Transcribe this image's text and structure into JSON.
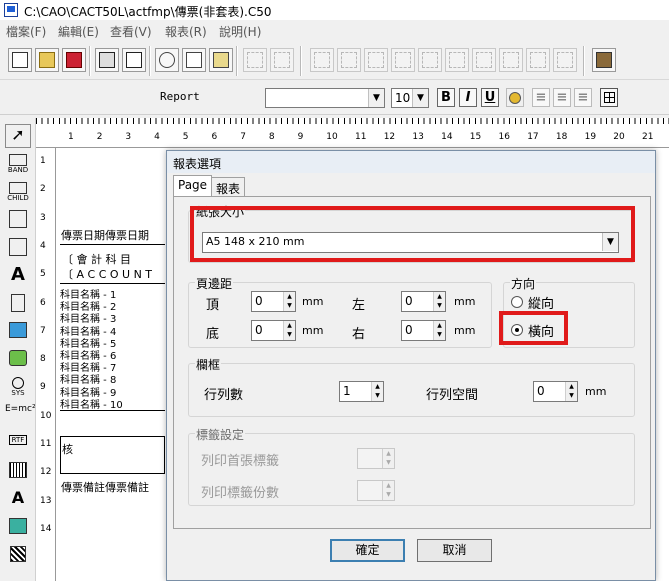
{
  "window": {
    "title": "C:\\CAO\\CACT50L\\actfmp\\傳票(非套表).C50",
    "icon": "app-icon"
  },
  "menu": [
    "檔案(F)",
    "編輯(E)",
    "查看(V)",
    "報表(R)",
    "說明(H)"
  ],
  "toolbar2": {
    "label": "Report",
    "font_value": "",
    "size_value": "10",
    "bold": "B",
    "italic": "I",
    "underline": "U"
  },
  "ruler": {
    "h_ticks": [
      "1",
      "2",
      "3",
      "4",
      "5",
      "6",
      "7",
      "8",
      "9",
      "10",
      "11",
      "12",
      "13",
      "14",
      "15",
      "16",
      "17",
      "18",
      "19",
      "20",
      "21"
    ],
    "v_ticks": [
      "1",
      "2",
      "3",
      "4",
      "5",
      "6",
      "7",
      "8",
      "9",
      "10",
      "11",
      "12",
      "13",
      "14"
    ]
  },
  "left_tools": [
    {
      "name": "pointer-tool",
      "label": ""
    },
    {
      "name": "band-tool",
      "label": "BAND"
    },
    {
      "name": "child-tool",
      "label": "CHILD"
    },
    {
      "name": "band3-tool",
      "label": ""
    },
    {
      "name": "band4-tool",
      "label": ""
    },
    {
      "name": "label-tool",
      "label": "A"
    },
    {
      "name": "memo-tool",
      "label": ""
    },
    {
      "name": "image-tool",
      "label": ""
    },
    {
      "name": "shape-tool",
      "label": ""
    },
    {
      "name": "sysdata-tool",
      "label": "SYS"
    },
    {
      "name": "expr-tool",
      "label": "E=mc²"
    },
    {
      "name": "rtf-tool",
      "label": "RTF"
    },
    {
      "name": "barcode-tool",
      "label": ""
    },
    {
      "name": "dblabel-tool",
      "label": "A"
    },
    {
      "name": "dbimage-tool",
      "label": ""
    },
    {
      "name": "qr-tool",
      "label": ""
    }
  ],
  "report": {
    "header": "傳票日期傳票日期",
    "company": "〔 會 計 科 目",
    "account": "〔 A C C O U N T",
    "items": [
      "科目名稱 - 1",
      "科目名稱 - 2",
      "科目名稱 - 3",
      "科目名稱 - 4",
      "科目名稱 - 5",
      "科目名稱 - 6",
      "科目名稱 - 7",
      "科目名稱 - 8",
      "科目名稱 - 9",
      "科目名稱 - 10"
    ],
    "box_left": "核",
    "footer": "傳票備註傳票備註"
  },
  "dialog": {
    "title": "報表選項",
    "tabs": [
      "Page",
      "報表"
    ],
    "paper": {
      "label": "紙張大小",
      "value": "A5 148 x 210 mm"
    },
    "margins": {
      "label": "頁邊距",
      "top_label": "頂",
      "top_value": "0",
      "bottom_label": "底",
      "bottom_value": "0",
      "left_label": "左",
      "left_value": "0",
      "right_label": "右",
      "right_value": "0",
      "unit": "mm"
    },
    "orientation": {
      "label": "方向",
      "portrait": "縱向",
      "landscape": "橫向",
      "selected": "landscape"
    },
    "columns": {
      "label": "欄框",
      "count_label": "行列數",
      "count_value": "1",
      "space_label": "行列空間",
      "space_value": "0",
      "unit": "mm"
    },
    "labels": {
      "label": "標籤設定",
      "first_label": "列印首張標籤",
      "copies_label": "列印標籤份數",
      "first_value": "",
      "copies_value": ""
    },
    "ok": "確定",
    "cancel": "取消"
  },
  "colors": {
    "highlight": "#e01a1a",
    "default_button_border": "#3c7fb1"
  }
}
